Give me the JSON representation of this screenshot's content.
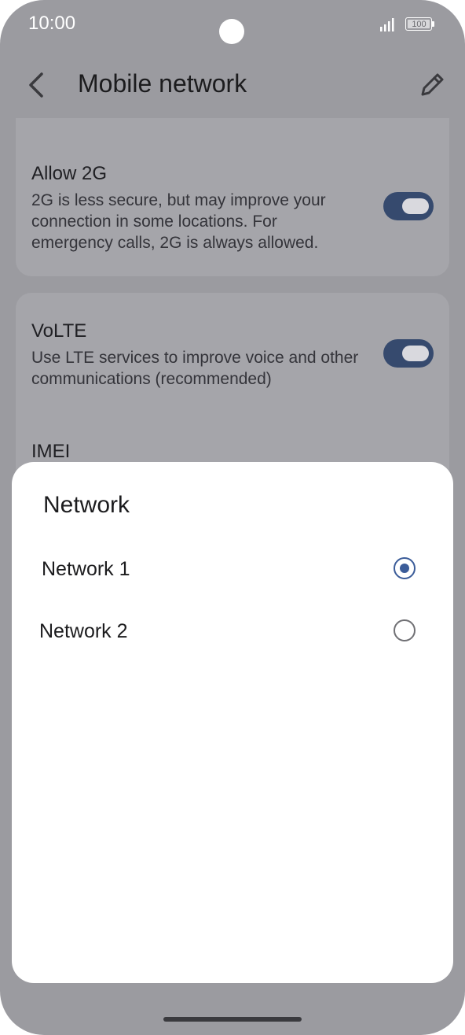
{
  "status_bar": {
    "time": "10:00",
    "battery_level": "100",
    "signal_icon": "signal-bars-icon",
    "battery_icon": "battery-icon"
  },
  "app_bar": {
    "title": "Mobile network",
    "back_icon": "chevron-left-icon",
    "edit_icon": "pencil-icon"
  },
  "settings": {
    "allow_2g": {
      "title": "Allow 2G",
      "description": "2G is less secure, but may improve your connection in some locations. For emergency calls, 2G is always allowed.",
      "enabled": true
    },
    "volte": {
      "title": "VoLTE",
      "description": "Use LTE services to improve voice and other communications (recommended)",
      "enabled": true
    },
    "imei": {
      "title": "IMEI"
    }
  },
  "dialog": {
    "title": "Network",
    "options": [
      {
        "label": "Network 1",
        "selected": true
      },
      {
        "label": "Network 2",
        "selected": false
      }
    ]
  },
  "colors": {
    "accent": "#3b5c99",
    "toggle_on": "#364a6e",
    "scrim_background": "#9b9ba0"
  }
}
